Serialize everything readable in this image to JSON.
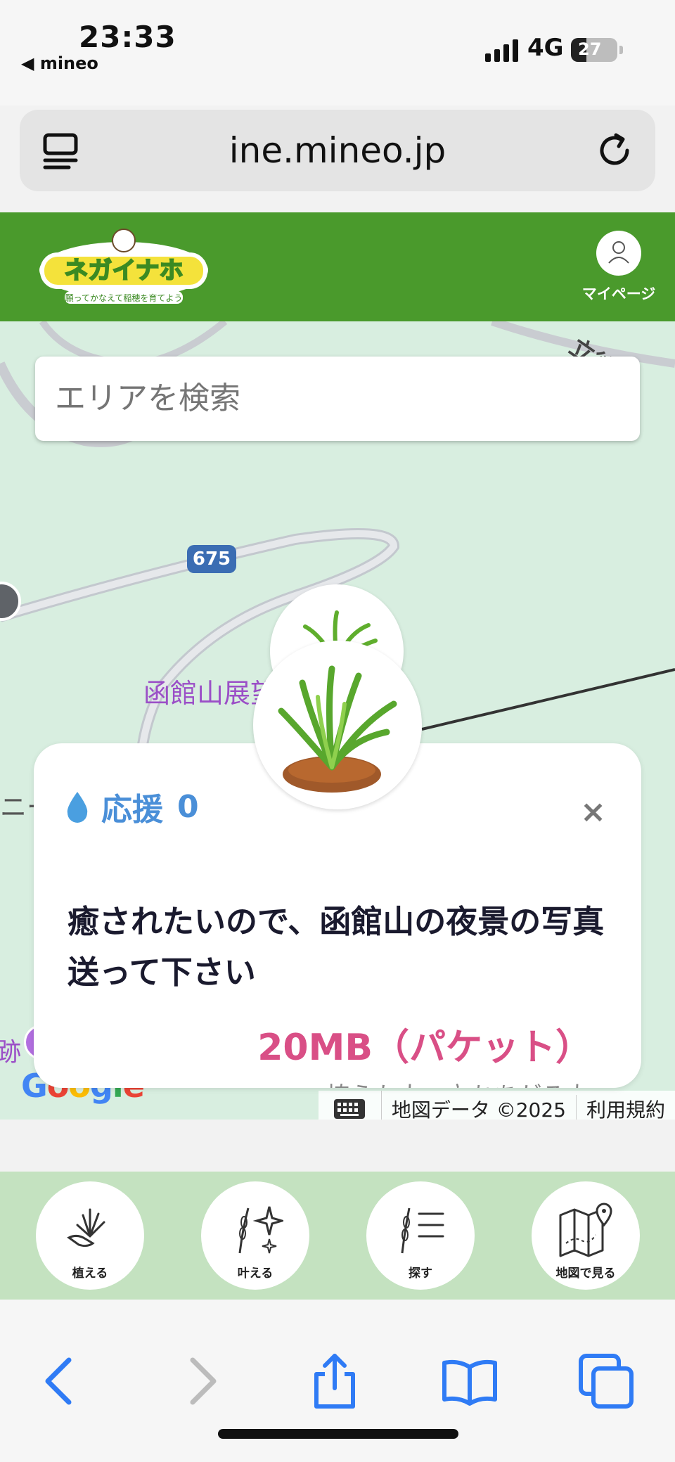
{
  "status_bar": {
    "time": "23:33",
    "back_app": "◀ mineo",
    "network": "4G",
    "battery": "27"
  },
  "browser": {
    "url": "ine.mineo.jp"
  },
  "site_header": {
    "logo_alt": "ネガイナホ",
    "mypage_label": "マイページ"
  },
  "map": {
    "search_placeholder": "エリアを検索",
    "route_number": "675",
    "place_label": "函館山展望",
    "road_label": "立待岬函館",
    "left_label": "ニー",
    "left_label2": "跡",
    "google": "Google",
    "keyboard_icon": "keyboard-icon",
    "map_data": "地図データ ©2025",
    "terms": "利用規約"
  },
  "card": {
    "support_label": "応援",
    "support_count": "0",
    "close_label": "×",
    "wish_text": "癒されたいので、函館山の夜景の写真送って下さい",
    "reward": "20MB（パケット）",
    "planter": "植えた人：立ちあがる人"
  },
  "bottom_nav": [
    {
      "label": "植える",
      "icon": "plant-hand-icon"
    },
    {
      "label": "叶える",
      "icon": "rice-sparkle-icon"
    },
    {
      "label": "探す",
      "icon": "rice-list-icon"
    },
    {
      "label": "地図で見る",
      "icon": "map-pin-icon"
    }
  ],
  "colors": {
    "header_green": "#4a9a2c",
    "nav_green": "#c4e2c0",
    "support_blue": "#4a8fd8",
    "reward_pink": "#d94f86",
    "safari_blue": "#2f7bf5"
  }
}
